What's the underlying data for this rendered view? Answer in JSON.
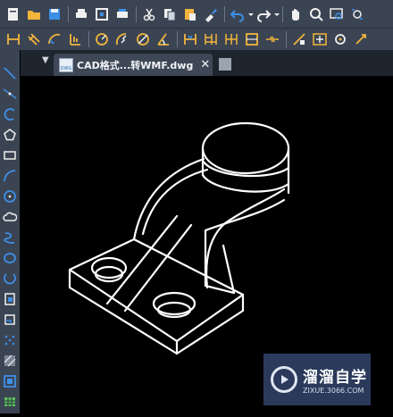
{
  "colors": {
    "toolbar": "#3b4453",
    "icon_blue": "#3d8fe6",
    "icon_white": "#f0f0f0",
    "drawing_stroke": "#ffffff",
    "canvas": "#000000"
  },
  "toolbar_top": [
    "new-file-icon",
    "open-folder-icon",
    "save-icon",
    "print-icon",
    "print-preview-icon",
    "plot-icon",
    "cut-icon",
    "copy-icon",
    "paste-icon",
    "match-properties-icon",
    "undo-icon",
    "redo-icon",
    "pan-icon",
    "zoom-realtime-icon",
    "zoom-window-icon",
    "zoom-previous-icon"
  ],
  "toolbar_dim": [
    "linear-dimension-icon",
    "aligned-dimension-icon",
    "arc-length-icon",
    "ordinate-icon",
    "radius-icon",
    "jogged-icon",
    "diameter-icon",
    "angular-icon",
    "quick-dimension-icon",
    "baseline-icon",
    "continue-icon",
    "dimension-space-icon",
    "dimension-break-icon",
    "tolerance-icon",
    "center-mark-icon",
    "inspect-icon"
  ],
  "tab": {
    "title": "CAD格式...转WMF.dwg",
    "close": "✕",
    "doc_icon_label": "DWG"
  },
  "sidebar_tools": [
    "line-icon",
    "construction-line-icon",
    "polyline-icon",
    "polygon-icon",
    "rectangle-icon",
    "arc-icon",
    "circle-icon",
    "revision-cloud-icon",
    "spline-icon",
    "ellipse-icon",
    "ellipse-arc-icon",
    "insert-block-icon",
    "make-block-icon",
    "point-icon",
    "hatch-icon",
    "gradient-icon",
    "region-icon",
    "table-icon"
  ],
  "watermark": {
    "brand": "溜溜自学",
    "url": "ZIXUE.3066.COM"
  }
}
